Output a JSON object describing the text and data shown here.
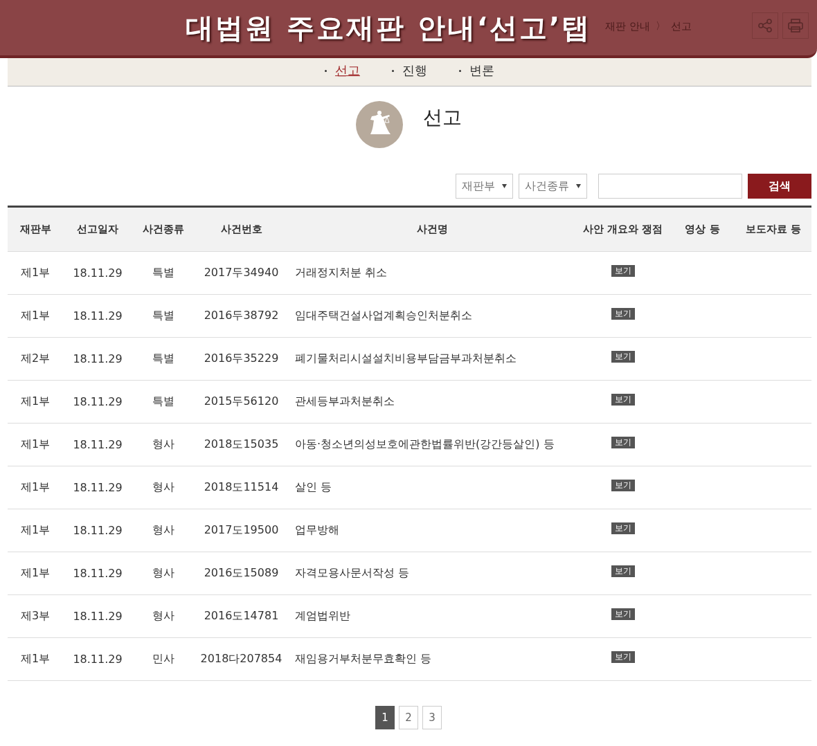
{
  "banner": {
    "title": "대법원 주요재판 안내‘선고’탭"
  },
  "breadcrumb": {
    "items": [
      "재판 안내",
      "선고"
    ],
    "separator": "〉"
  },
  "subtabs": [
    {
      "label": "선고",
      "selected": true
    },
    {
      "label": "진행",
      "selected": false
    },
    {
      "label": "변론",
      "selected": false
    }
  ],
  "heading": "선고",
  "filters": {
    "selects": [
      "재판부",
      "사건종류"
    ],
    "search_button": "검색"
  },
  "table": {
    "columns": [
      "재판부",
      "선고일자",
      "사건종류",
      "사건번호",
      "사건명",
      "사안 개요와 쟁점",
      "영상 등",
      "보도자료 등"
    ],
    "rows": [
      {
        "cells": [
          "제1부",
          "18.11.29",
          "특별",
          "2017두34940",
          "거래정지처분 취소"
        ],
        "button": "보기"
      },
      {
        "cells": [
          "제1부",
          "18.11.29",
          "특별",
          "2016두38792",
          "임대주택건설사업계획승인처분취소"
        ],
        "button": "보기"
      },
      {
        "cells": [
          "제2부",
          "18.11.29",
          "특별",
          "2016두35229",
          "폐기물처리시설설치비용부담금부과처분취소"
        ],
        "button": "보기"
      },
      {
        "cells": [
          "제1부",
          "18.11.29",
          "특별",
          "2015두56120",
          "관세등부과처분취소"
        ],
        "button": "보기"
      },
      {
        "cells": [
          "제1부",
          "18.11.29",
          "형사",
          "2018도15035",
          "아동·청소년의성보호에관한법률위반(강간등살인) 등"
        ],
        "button": "보기"
      },
      {
        "cells": [
          "제1부",
          "18.11.29",
          "형사",
          "2018도11514",
          "살인 등"
        ],
        "button": "보기"
      },
      {
        "cells": [
          "제1부",
          "18.11.29",
          "형사",
          "2017도19500",
          "업무방해"
        ],
        "button": "보기"
      },
      {
        "cells": [
          "제1부",
          "18.11.29",
          "형사",
          "2016도15089",
          "자격모용사문서작성 등"
        ],
        "button": "보기"
      },
      {
        "cells": [
          "제3부",
          "18.11.29",
          "형사",
          "2016도14781",
          "계엄법위반"
        ],
        "button": "보기"
      },
      {
        "cells": [
          "제1부",
          "18.11.29",
          "민사",
          "2018다207854",
          "재임용거부처분무효확인 등"
        ],
        "button": "보기"
      }
    ]
  },
  "pagination": [
    {
      "label": "1",
      "selected": true
    },
    {
      "label": "2",
      "selected": false
    },
    {
      "label": "3",
      "selected": false
    }
  ]
}
